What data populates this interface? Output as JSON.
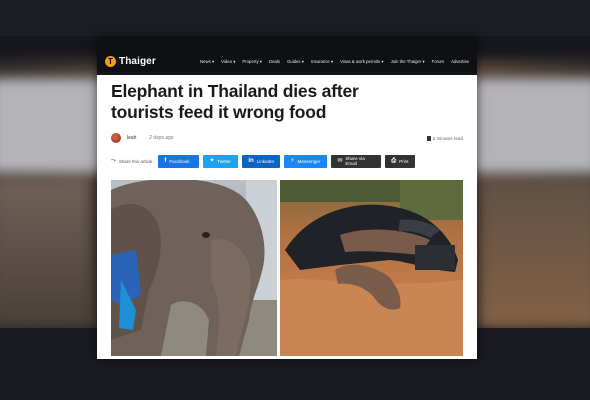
{
  "site": {
    "logo_text": "Thaiger",
    "logo_mark": "T",
    "nav": [
      "News ▾",
      "Video ▾",
      "Property ▾",
      "Deals",
      "Guides ▾",
      "Insurance ▾",
      "Visas & work permits ▾",
      "Join the Thaiger ▾",
      "Forum",
      "Advertise"
    ]
  },
  "article": {
    "headline_line1": "Elephant in Thailand dies after",
    "headline_line2": "tourists feed it wrong food",
    "author": "leah",
    "date": "2 days ago",
    "read_time": "2 minutes read"
  },
  "share": {
    "label": "Share this article",
    "buttons": {
      "facebook": "Facebook",
      "twitter": "Twitter",
      "linkedin": "LinkedIn",
      "messenger": "Messenger",
      "email": "Share via Email",
      "print": "Print"
    }
  },
  "colors": {
    "accent": "#f39a1f",
    "facebook": "#1b74e4",
    "twitter": "#1da1f2",
    "linkedin": "#0a66c2",
    "messenger": "#1b86f5"
  },
  "icons": [
    "share-icon",
    "facebook-icon",
    "twitter-icon",
    "linkedin-icon",
    "messenger-icon",
    "email-icon",
    "print-icon",
    "book-icon"
  ]
}
